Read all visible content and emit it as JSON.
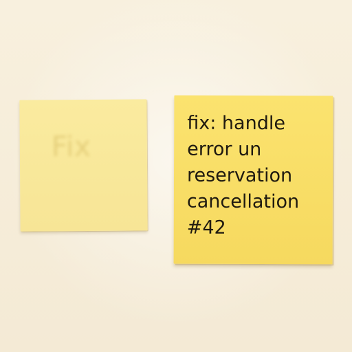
{
  "notes": {
    "left": {
      "text": "Fix"
    },
    "right": {
      "lines": [
        "fix: handle",
        "error un",
        "reservation",
        "cancellation",
        "#42"
      ]
    }
  },
  "colors": {
    "background": "#f7eedb",
    "left_note": "#f8e79b",
    "right_note": "#f8dc64",
    "text": "#1f1a10"
  }
}
